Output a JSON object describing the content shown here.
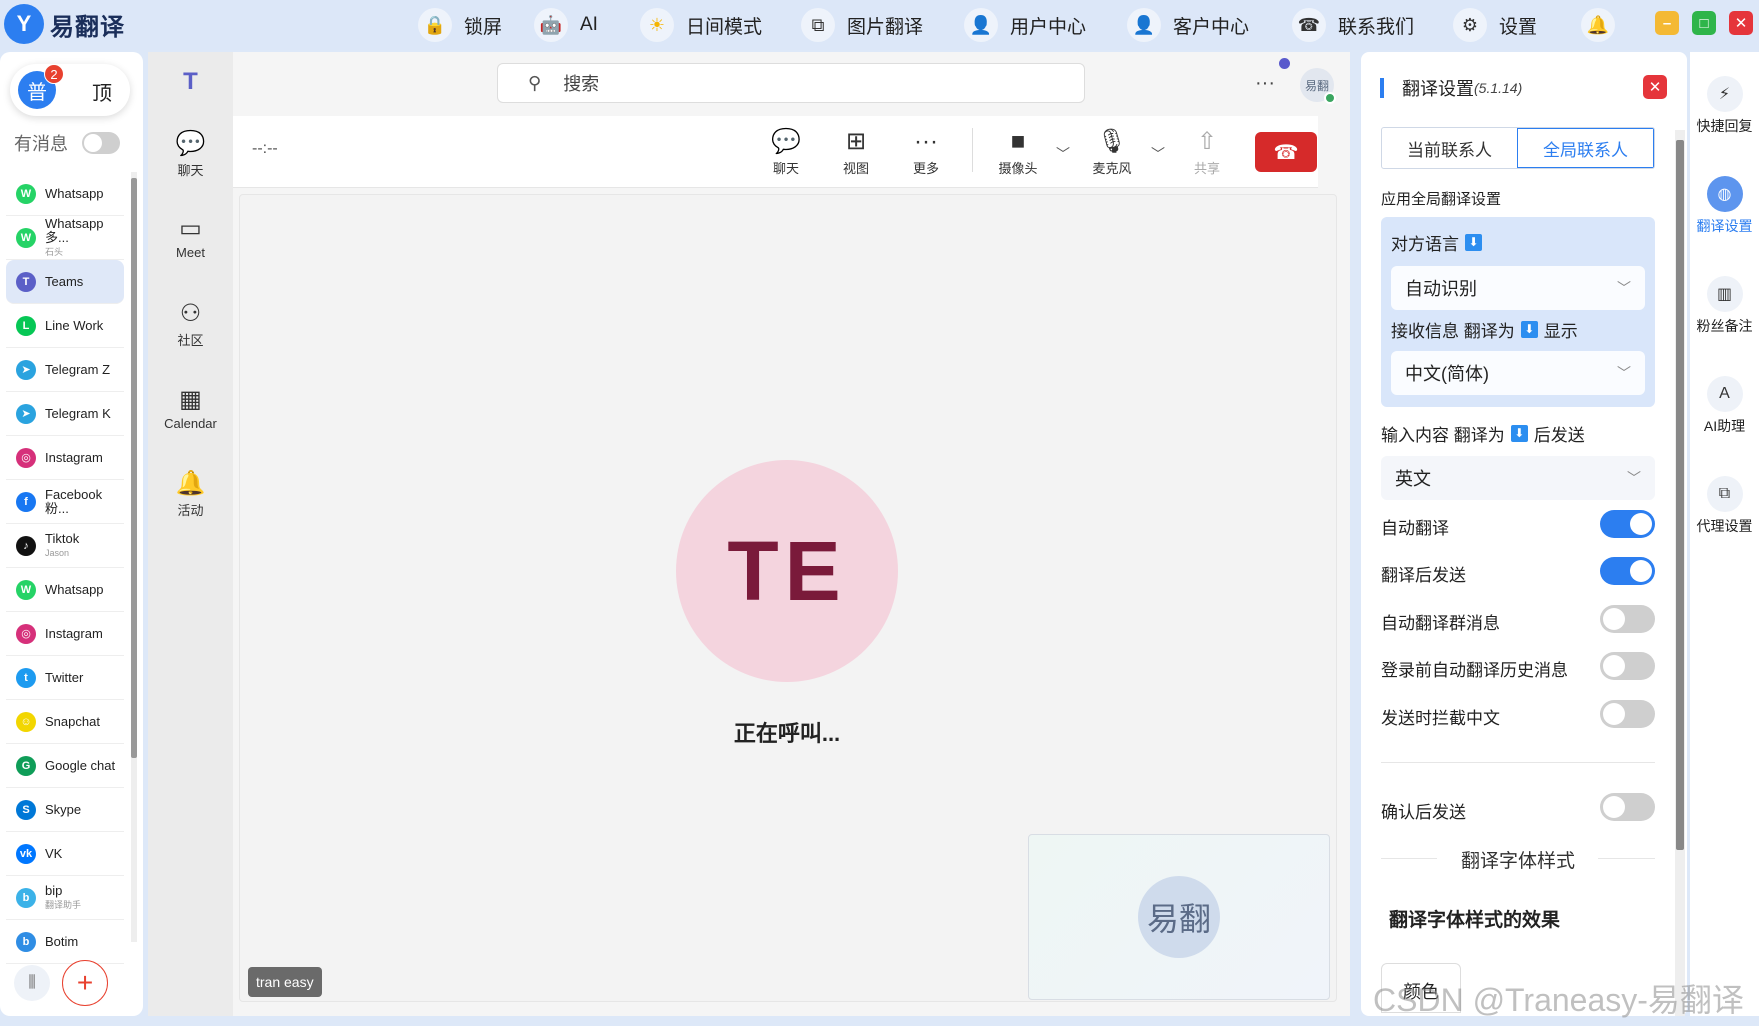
{
  "app": {
    "logo_mark": "Y",
    "name": "易翻译"
  },
  "topbar": {
    "items": [
      {
        "label": "锁屏",
        "icon": "lock-icon"
      },
      {
        "label": "AI",
        "icon": "robot-icon"
      },
      {
        "label": "日间模式",
        "icon": "sun-icon"
      },
      {
        "label": "图片翻译",
        "icon": "image-translate-icon"
      },
      {
        "label": "用户中心",
        "icon": "user-icon"
      },
      {
        "label": "客户中心",
        "icon": "customer-icon"
      },
      {
        "label": "联系我们",
        "icon": "phone-icon"
      },
      {
        "label": "设置",
        "icon": "gear-icon"
      }
    ],
    "window": {
      "min": "–",
      "max": "□",
      "close": "✕"
    }
  },
  "leftbar": {
    "pin_avatar_text": "普",
    "pin_badge": "2",
    "pin_label": "顶",
    "msg_toggle_label": "有消息",
    "apps": [
      {
        "name": "Whatsapp",
        "sub": "",
        "color": "#25d366",
        "glyph": "W"
      },
      {
        "name": "Whatsapp 多...",
        "sub": "石头",
        "color": "#25d366",
        "glyph": "W"
      },
      {
        "name": "Teams",
        "sub": "",
        "color": "#5b5fc7",
        "glyph": "T"
      },
      {
        "name": "Line Work",
        "sub": "",
        "color": "#06c755",
        "glyph": "L"
      },
      {
        "name": "Telegram Z",
        "sub": "",
        "color": "#2aa3df",
        "glyph": "➤"
      },
      {
        "name": "Telegram K",
        "sub": "",
        "color": "#2aa3df",
        "glyph": "➤"
      },
      {
        "name": "Instagram",
        "sub": "",
        "color": "#d6307a",
        "glyph": "◎"
      },
      {
        "name": "Facebook 粉...",
        "sub": "",
        "color": "#1877f2",
        "glyph": "f"
      },
      {
        "name": "Tiktok",
        "sub": "Jason",
        "color": "#111111",
        "glyph": "♪"
      },
      {
        "name": "Whatsapp",
        "sub": "",
        "color": "#25d366",
        "glyph": "W"
      },
      {
        "name": "Instagram",
        "sub": "",
        "color": "#d6307a",
        "glyph": "◎"
      },
      {
        "name": "Twitter",
        "sub": "",
        "color": "#1d9bf0",
        "glyph": "t"
      },
      {
        "name": "Snapchat",
        "sub": "",
        "color": "#f2d600",
        "glyph": "☺"
      },
      {
        "name": "Google chat",
        "sub": "",
        "color": "#0f9d58",
        "glyph": "G"
      },
      {
        "name": "Skype",
        "sub": "",
        "color": "#0078d7",
        "glyph": "S"
      },
      {
        "name": "VK",
        "sub": "",
        "color": "#0077ff",
        "glyph": "vk"
      },
      {
        "name": "bip",
        "sub": "翻译助手",
        "color": "#3bb2e8",
        "glyph": "b"
      },
      {
        "name": "Botim",
        "sub": "",
        "color": "#2f8de4",
        "glyph": "b"
      }
    ]
  },
  "teams_rail": {
    "items": [
      {
        "label": "",
        "icon": "teams-logo-icon"
      },
      {
        "label": "聊天",
        "icon": "chat-icon"
      },
      {
        "label": "Meet",
        "icon": "video-icon"
      },
      {
        "label": "社区",
        "icon": "community-icon"
      },
      {
        "label": "Calendar",
        "icon": "calendar-icon"
      },
      {
        "label": "活动",
        "icon": "bell-icon"
      }
    ]
  },
  "main": {
    "search_placeholder": "搜索",
    "top_avatar": "易翻",
    "call_time": "--:--",
    "controls": [
      {
        "label": "聊天",
        "icon": "chat-icon"
      },
      {
        "label": "视图",
        "icon": "grid-icon"
      },
      {
        "label": "更多",
        "icon": "more-icon"
      },
      {
        "label": "摄像头",
        "icon": "camera-off-icon"
      },
      {
        "label": "麦克风",
        "icon": "mic-icon"
      },
      {
        "label": "共享",
        "icon": "share-icon"
      }
    ],
    "callee_initials": "TE",
    "calling_text": "正在呼叫...",
    "self_avatar": "易翻",
    "tag": "tran easy"
  },
  "settings": {
    "title": "翻译设置",
    "version": "(5.1.14)",
    "tabs": [
      "当前联系人",
      "全局联系人"
    ],
    "apply_global": "应用全局翻译设置",
    "target_lang_label": "对方语言",
    "target_lang_value": "自动识别",
    "receive_label_a": "接收信息 翻译为",
    "receive_label_b": "显示",
    "receive_value": "中文(简体)",
    "input_label_a": "输入内容 翻译为",
    "input_label_b": "后发送",
    "input_value": "英文",
    "toggles": [
      {
        "label": "自动翻译",
        "on": true
      },
      {
        "label": "翻译后发送",
        "on": true
      },
      {
        "label": "自动翻译群消息",
        "on": false
      },
      {
        "label": "登录前自动翻译历史消息",
        "on": false
      },
      {
        "label": "发送时拦截中文",
        "on": false
      },
      {
        "label": "确认后发送",
        "on": false
      }
    ],
    "font_section": "翻译字体样式",
    "font_preview": "翻译字体样式的效果",
    "color_btn": "颜色"
  },
  "right_rail": {
    "items": [
      {
        "label": "快捷回复",
        "icon": "quick-reply-icon"
      },
      {
        "label": "翻译设置",
        "icon": "globe-icon"
      },
      {
        "label": "粉丝备注",
        "icon": "notes-icon"
      },
      {
        "label": "AI助理",
        "icon": "ai-assistant-icon"
      },
      {
        "label": "代理设置",
        "icon": "proxy-icon"
      }
    ]
  },
  "watermark": "CSDN @Traneasy-易翻译"
}
